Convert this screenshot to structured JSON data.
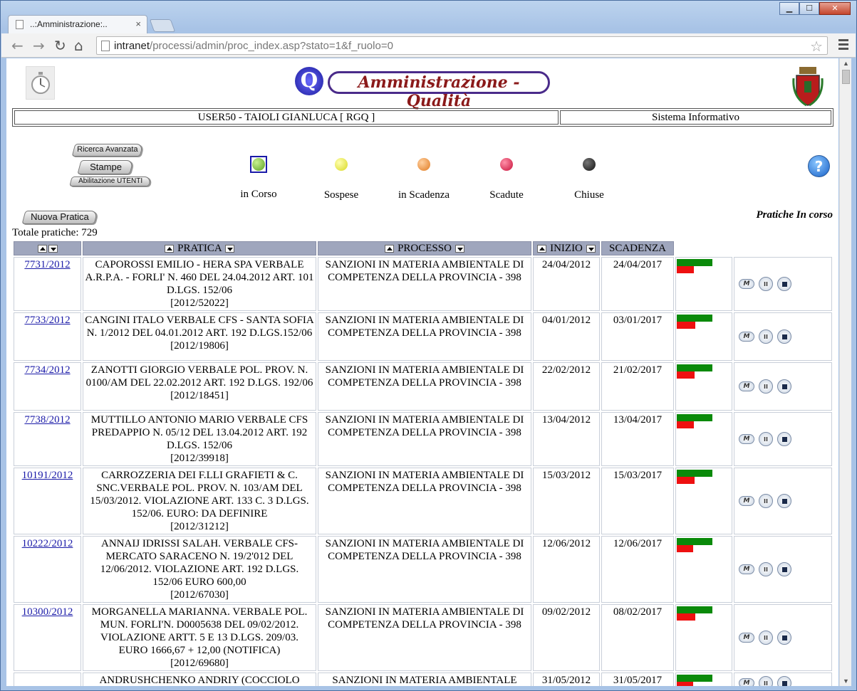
{
  "browser": {
    "tab_title": "..:Amministrazione:..",
    "url_host": "intranet",
    "url_path": "/processi/admin/proc_index.asp?stato=1&f_ruolo=0",
    "tab_close": "×",
    "btn_minimize": "▁",
    "btn_maximize": "☐",
    "btn_close": "✕"
  },
  "header": {
    "logo_text": "Amministrazione - Qualità",
    "logo_letter": "Q",
    "user": "USER50 - TAIOLI GIANLUCA [ RGQ ]",
    "system": "Sistema Informativo"
  },
  "buttons": {
    "ricerca": "Ricerca Avanzata",
    "stampe": "Stampe",
    "abilitazione": "Abilitazione UTENTI",
    "nuova": "Nuova Pratica",
    "help": "?"
  },
  "statuses": [
    {
      "label": "in Corso",
      "color": "#7fc63a"
    },
    {
      "label": "Sospese",
      "color": "#f2f23a"
    },
    {
      "label": "in Scadenza",
      "color": "#f2a050"
    },
    {
      "label": "Scadute",
      "color": "#e8204a"
    },
    {
      "label": "Chiuse",
      "color": "#222222"
    }
  ],
  "list_title": "Pratiche In corso",
  "totale": "Totale pratiche: 729",
  "columns": {
    "pratica": "PRATICA",
    "processo": "PROCESSO",
    "inizio": "INIZIO",
    "scadenza": "SCADENZA"
  },
  "rows": [
    {
      "num": "7731/2012",
      "pratica": "CAPOROSSI EMILIO - HERA SPA VERBALE A.R.P.A. - FORLI' N. 460 DEL 24.04.2012 ART. 101 D.LGS. 152/06",
      "prot": "[2012/52022]",
      "processo": "SANZIONI IN MATERIA AMBIENTALE DI COMPETENZA DELLA PROVINCIA - 398",
      "inizio": "24/04/2012",
      "scadenza": "24/04/2017",
      "elapsed": 0.48
    },
    {
      "num": "7733/2012",
      "pratica": "CANGINI ITALO VERBALE CFS - SANTA SOFIA N. 1/2012 DEL 04.01.2012 ART. 192 D.LGS.152/06",
      "prot": "[2012/19806]",
      "processo": "SANZIONI IN MATERIA AMBIENTALE DI COMPETENZA DELLA PROVINCIA - 398",
      "inizio": "04/01/2012",
      "scadenza": "03/01/2017",
      "elapsed": 0.52
    },
    {
      "num": "7734/2012",
      "pratica": "ZANOTTI GIORGIO VERBALE POL. PROV. N. 0100/AM DEL 22.02.2012 ART. 192 D.LGS. 192/06",
      "prot": "[2012/18451]",
      "processo": "SANZIONI IN MATERIA AMBIENTALE DI COMPETENZA DELLA PROVINCIA - 398",
      "inizio": "22/02/2012",
      "scadenza": "21/02/2017",
      "elapsed": 0.5
    },
    {
      "num": "7738/2012",
      "pratica": "MUTTILLO ANTONIO MARIO VERBALE CFS PREDAPPIO N. 05/12 DEL 13.04.2012 ART. 192 D.LGS. 152/06",
      "prot": "[2012/39918]",
      "processo": "SANZIONI IN MATERIA AMBIENTALE DI COMPETENZA DELLA PROVINCIA - 398",
      "inizio": "13/04/2012",
      "scadenza": "13/04/2017",
      "elapsed": 0.48
    },
    {
      "num": "10191/2012",
      "pratica": "CARROZZERIA DEI F.LLI GRAFIETI & C. SNC.VERBALE POL. PROV. N. 103/AM DEL 15/03/2012. VIOLAZIONE ART. 133 C. 3 D.LGS. 152/06. EURO: DA DEFINIRE",
      "prot": "[2012/31212]",
      "processo": "SANZIONI IN MATERIA AMBIENTALE DI COMPETENZA DELLA PROVINCIA - 398",
      "inizio": "15/03/2012",
      "scadenza": "15/03/2017",
      "elapsed": 0.5
    },
    {
      "num": "10222/2012",
      "pratica": "ANNAIJ IDRISSI SALAH. VERBALE CFS-MERCATO SARACENO N. 19/2'012 DEL 12/06/2012. VIOLAZIONE ART. 192 D.LGS. 152/06 EURO 600,00",
      "prot": "[2012/67030]",
      "processo": "SANZIONI IN MATERIA AMBIENTALE DI COMPETENZA DELLA PROVINCIA - 398",
      "inizio": "12/06/2012",
      "scadenza": "12/06/2017",
      "elapsed": 0.46
    },
    {
      "num": "10300/2012",
      "pratica": "MORGANELLA MARIANNA. VERBALE POL. MUN. FORLI'N. D0005638 DEL 09/02/2012. VIOLAZIONE ARTT. 5 E 13 D.LGS. 209/03. EURO 1666,67 + 12,00 (NOTIFICA)",
      "prot": "[2012/69680]",
      "processo": "SANZIONI IN MATERIA AMBIENTALE DI COMPETENZA DELLA PROVINCIA - 398",
      "inizio": "09/02/2012",
      "scadenza": "08/02/2017",
      "elapsed": 0.52
    },
    {
      "num": "",
      "pratica": "ANDRUSHCHENKO ANDRIY (COCCIOLO",
      "prot": "",
      "processo": "SANZIONI IN MATERIA AMBIENTALE",
      "inizio": "31/05/2012",
      "scadenza": "31/05/2017",
      "elapsed": 0.46
    }
  ]
}
